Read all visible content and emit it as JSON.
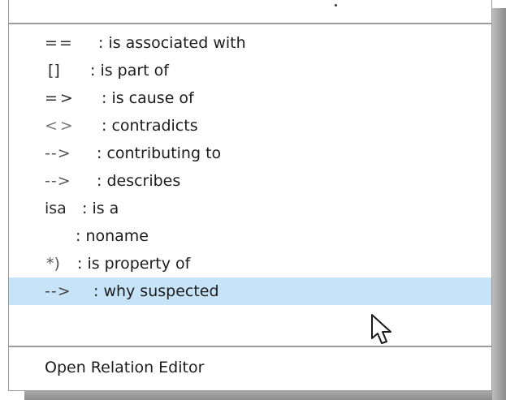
{
  "menu": {
    "relations": [
      {
        "symbol": "==",
        "label": ": is associated with"
      },
      {
        "symbol": "[]",
        "label": ": is part of"
      },
      {
        "symbol": "=>",
        "label": ": is cause of"
      },
      {
        "symbol": "<>",
        "label": ": contradicts"
      },
      {
        "symbol": "-->",
        "label": ": contributing to"
      },
      {
        "symbol": "-->",
        "label": ": describes"
      },
      {
        "symbol": "isa",
        "label": ": is a"
      },
      {
        "symbol": "",
        "label": ": noname"
      },
      {
        "symbol": "*)",
        "label": ": is property of"
      },
      {
        "symbol": "-->",
        "label": ": why suspected",
        "highlighted": true
      }
    ],
    "open_editor_label": "Open Relation Editor"
  },
  "colors": {
    "highlight": "#c6e3f7",
    "separator": "#9b9b9b",
    "text": "#1c1c1c"
  },
  "cursor": {
    "icon": "arrow-pointer-icon"
  }
}
